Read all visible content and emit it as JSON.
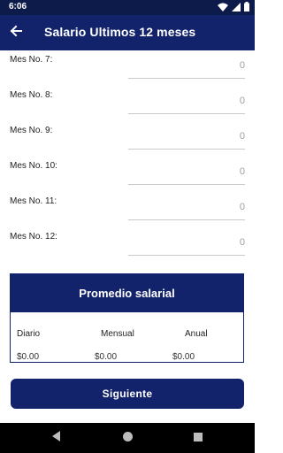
{
  "status_bar": {
    "time": "6:06",
    "icons": [
      "wifi-icon",
      "signal-icon",
      "battery-icon"
    ]
  },
  "app_bar": {
    "title": "Salario Ultimos 12 meses",
    "back_icon": "arrow-back-icon"
  },
  "months": [
    {
      "label": "Mes No. 7:",
      "value": "0"
    },
    {
      "label": "Mes No. 8:",
      "value": "0"
    },
    {
      "label": "Mes No. 9:",
      "value": "0"
    },
    {
      "label": "Mes No. 10:",
      "value": "0"
    },
    {
      "label": "Mes No. 11:",
      "value": "0"
    },
    {
      "label": "Mes No. 12:",
      "value": "0"
    }
  ],
  "summary": {
    "title": "Promedio salarial",
    "columns": [
      {
        "label": "Diario",
        "value": "$0.00"
      },
      {
        "label": "Mensual",
        "value": "$0.00"
      },
      {
        "label": "Anual",
        "value": "$0.00"
      }
    ]
  },
  "next_button": {
    "label": "Siguiente"
  },
  "nav_bar": {
    "icons": [
      "back-triangle-icon",
      "home-circle-icon",
      "recents-square-icon"
    ]
  },
  "colors": {
    "status_bar": "#0d1b4b",
    "primary": "#13236b",
    "input_text": "#9e9e9e",
    "nav_bar": "#000000"
  }
}
